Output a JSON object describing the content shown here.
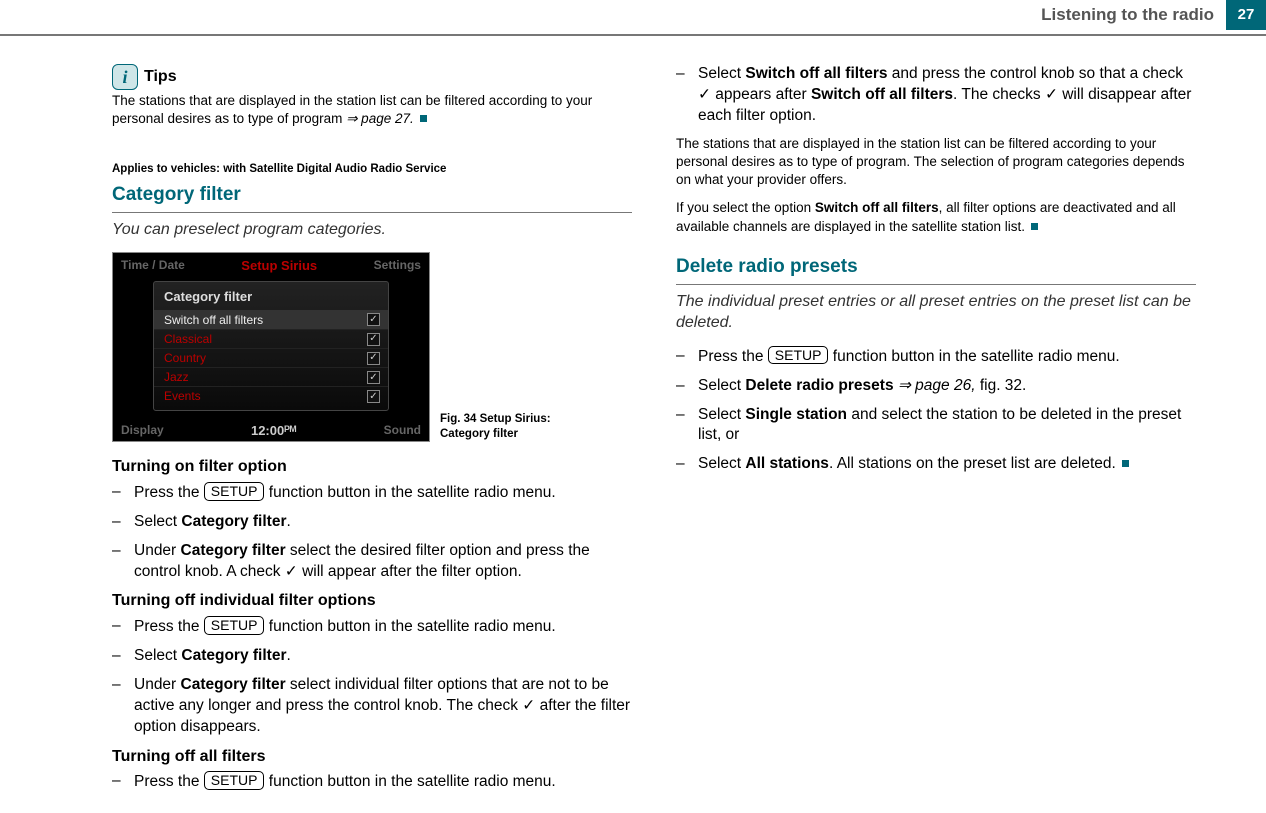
{
  "header": {
    "title": "Listening to the radio",
    "page_num": "27"
  },
  "tips": {
    "label": "Tips",
    "body_1": "The stations that are displayed in the station list can be filtered according to your personal desires as to type of program ",
    "body_ref": "⇒ page 27."
  },
  "applies_note": "Applies to vehicles: with Satellite Digital Audio Radio Service",
  "section1": {
    "heading": "Category filter",
    "subtitle": "You can preselect program categories."
  },
  "figure": {
    "top_left": "Time / Date",
    "top_center": "Setup Sirius",
    "top_right": "Settings",
    "panel_title": "Category filter",
    "items": [
      {
        "label": "Switch off all filters",
        "hl": true,
        "check": true
      },
      {
        "label": "Classical",
        "hl": false,
        "check": true
      },
      {
        "label": "Country",
        "hl": false,
        "check": true
      },
      {
        "label": "Jazz",
        "hl": false,
        "check": true
      },
      {
        "label": "Events",
        "hl": false,
        "check": true
      }
    ],
    "bottom_left": "Display",
    "clock": "12:00ᴾᴹ",
    "bottom_right": "Sound",
    "caption_a": "Fig. 34   Setup Sirius: Category filter"
  },
  "sub_on": "Turning on filter option",
  "sub_off_ind": "Turning off individual filter options",
  "sub_off_all": "Turning off all filters",
  "steps": {
    "press_setup_a": "Press the ",
    "press_setup_b": " function button in the satellite radio menu.",
    "setup_label": "SETUP",
    "select_cat_a": "Select ",
    "select_cat_b": "Category filter",
    "select_cat_c": ".",
    "under_cat_on_a": "Under ",
    "under_cat_on_b": "Category filter",
    "under_cat_on_c": " select the desired filter option and press the control knob. A check ✓ will appear after the filter option.",
    "under_cat_off_a": "Under ",
    "under_cat_off_b": "Category filter",
    "under_cat_off_c": " select individual filter options that are not to be active any longer and press the control knob. The check ✓ after the filter option disappears.",
    "switch_off_a": "Select ",
    "switch_off_b": "Switch off all filters",
    "switch_off_c": " and press the control knob so that a check ✓ appears after ",
    "switch_off_d": "Switch off all filters",
    "switch_off_e": ". The checks ✓ will disappear after each filter option."
  },
  "explain1": "The stations that are displayed in the station list can be filtered according to your personal desires as to type of program. The selection of program categories depends on what your provider offers.",
  "explain2_a": "If you select the option ",
  "explain2_b": "Switch off all filters",
  "explain2_c": ", all filter options are deactivated and all available channels are displayed in the satellite station list.",
  "section2": {
    "heading": "Delete radio presets",
    "subtitle": "The individual preset entries or all preset entries on the preset list can be deleted."
  },
  "del_steps": {
    "sel_del_a": "Select ",
    "sel_del_b": "Delete radio presets",
    "sel_del_c": " ⇒ page 26, ",
    "sel_del_d": "fig. 32.",
    "single_a": "Select ",
    "single_b": "Single station",
    "single_c": " and select the station to be deleted in the preset list, or",
    "all_a": "Select ",
    "all_b": "All stations",
    "all_c": ". All stations on the preset list are deleted."
  }
}
